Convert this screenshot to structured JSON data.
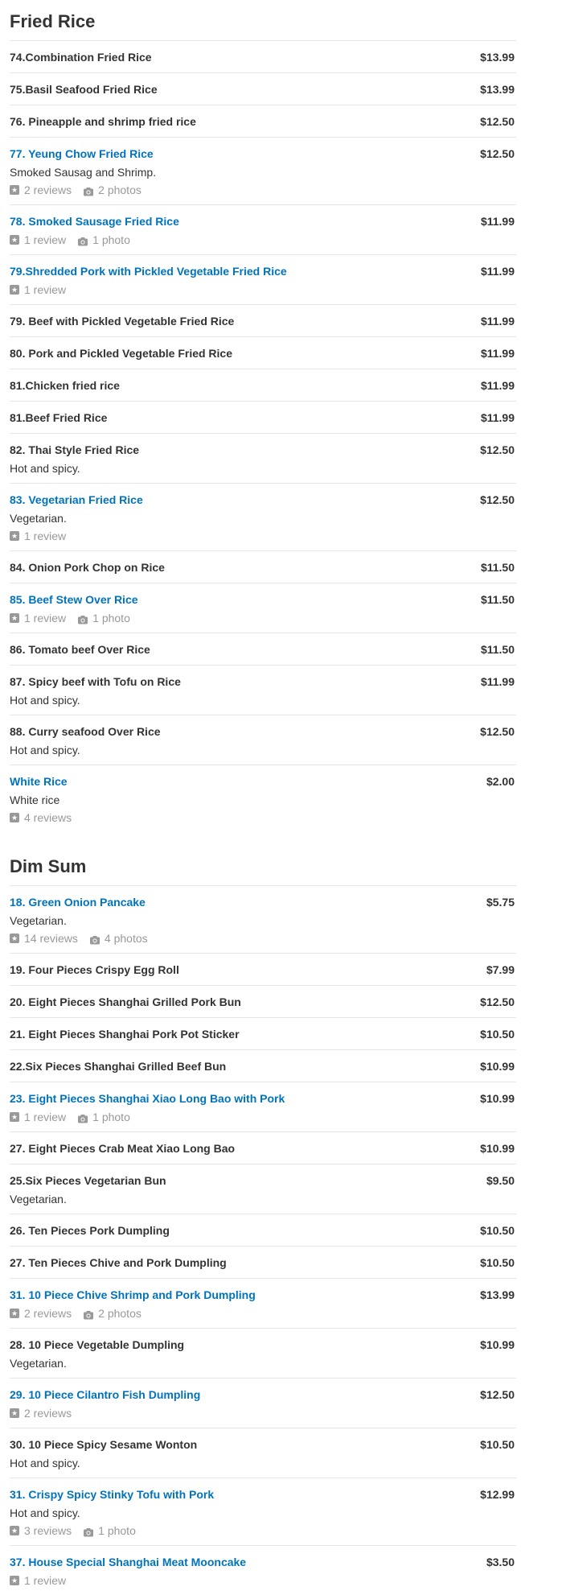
{
  "sections": [
    {
      "title": "Fried Rice",
      "items": [
        {
          "name": "74.Combination Fried Rice",
          "price": "$13.99"
        },
        {
          "name": "75.Basil Seafood Fried Rice",
          "price": "$13.99"
        },
        {
          "name": "76. Pineapple and shrimp fried rice",
          "price": "$12.50"
        },
        {
          "name": "77. Yeung Chow Fried Rice",
          "price": "$12.50",
          "link": true,
          "desc": "Smoked Sausag and Shrimp.",
          "reviews": "2 reviews",
          "photos": "2 photos"
        },
        {
          "name": "78. Smoked Sausage Fried Rice",
          "price": "$11.99",
          "link": true,
          "reviews": "1 review",
          "photos": "1 photo"
        },
        {
          "name": "79.Shredded Pork with Pickled Vegetable Fried Rice",
          "price": "$11.99",
          "link": true,
          "reviews": "1 review"
        },
        {
          "name": "79. Beef with Pickled Vegetable Fried Rice",
          "price": "$11.99"
        },
        {
          "name": "80. Pork and Pickled Vegetable Fried Rice",
          "price": "$11.99"
        },
        {
          "name": "81.Chicken fried rice",
          "price": "$11.99"
        },
        {
          "name": "81.Beef Fried Rice",
          "price": "$11.99"
        },
        {
          "name": "82. Thai Style Fried Rice",
          "price": "$12.50",
          "desc": "Hot and spicy."
        },
        {
          "name": "83. Vegetarian Fried Rice",
          "price": "$12.50",
          "link": true,
          "desc": "Vegetarian.",
          "reviews": "1 review"
        },
        {
          "name": "84. Onion Pork Chop on Rice",
          "price": "$11.50"
        },
        {
          "name": "85. Beef Stew Over Rice",
          "price": "$11.50",
          "link": true,
          "reviews": "1 review",
          "photos": "1 photo"
        },
        {
          "name": "86. Tomato beef Over Rice",
          "price": "$11.50"
        },
        {
          "name": "87. Spicy beef with Tofu on Rice",
          "price": "$11.99",
          "desc": "Hot and spicy."
        },
        {
          "name": "88. Curry seafood Over Rice",
          "price": "$12.50",
          "desc": "Hot and spicy."
        },
        {
          "name": "White Rice",
          "price": "$2.00",
          "link": true,
          "desc": "White rice",
          "reviews": "4 reviews"
        }
      ]
    },
    {
      "title": "Dim Sum",
      "items": [
        {
          "name": "18. Green Onion Pancake",
          "price": "$5.75",
          "link": true,
          "desc": "Vegetarian.",
          "reviews": "14 reviews",
          "photos": "4 photos"
        },
        {
          "name": "19. Four Pieces Crispy Egg Roll",
          "price": "$7.99"
        },
        {
          "name": "20. Eight Pieces Shanghai Grilled Pork Bun",
          "price": "$12.50"
        },
        {
          "name": "21. Eight Pieces Shanghai Pork Pot Sticker",
          "price": "$10.50"
        },
        {
          "name": "22.Six Pieces Shanghai Grilled Beef Bun",
          "price": "$10.99"
        },
        {
          "name": "23. Eight Pieces Shanghai Xiao Long Bao with Pork",
          "price": "$10.99",
          "link": true,
          "reviews": "1 review",
          "photos": "1 photo"
        },
        {
          "name": "27. Eight Pieces Crab Meat Xiao Long Bao",
          "price": "$10.99"
        },
        {
          "name": "25.Six Pieces Vegetarian Bun",
          "price": "$9.50",
          "desc": "Vegetarian."
        },
        {
          "name": "26. Ten Pieces Pork Dumpling",
          "price": "$10.50"
        },
        {
          "name": "27. Ten Pieces Chive and Pork Dumpling",
          "price": "$10.50"
        },
        {
          "name": "31. 10 Piece Chive Shrimp and Pork Dumpling",
          "price": "$13.99",
          "link": true,
          "reviews": "2 reviews",
          "photos": "2 photos"
        },
        {
          "name": "28. 10 Piece Vegetable Dumpling",
          "price": "$10.99",
          "desc": "Vegetarian."
        },
        {
          "name": "29. 10 Piece Cilantro Fish Dumpling",
          "price": "$12.50",
          "link": true,
          "reviews": "2 reviews"
        },
        {
          "name": "30. 10 Piece Spicy Sesame Wonton",
          "price": "$10.50",
          "desc": "Hot and spicy."
        },
        {
          "name": "31. Crispy Spicy Stinky Tofu with Pork",
          "price": "$12.99",
          "link": true,
          "desc": "Hot and spicy.",
          "reviews": "3 reviews",
          "photos": "1 photo"
        },
        {
          "name": "37. House Special Shanghai Meat Mooncake",
          "price": "$3.50",
          "link": true,
          "reviews": "1 review"
        }
      ]
    }
  ],
  "colors": {
    "link": "#0073bb",
    "text": "#333333",
    "meta": "#999999",
    "divider": "#e6e6e6"
  },
  "icons": {
    "reviews": "star-icon",
    "photos": "camera-icon"
  }
}
